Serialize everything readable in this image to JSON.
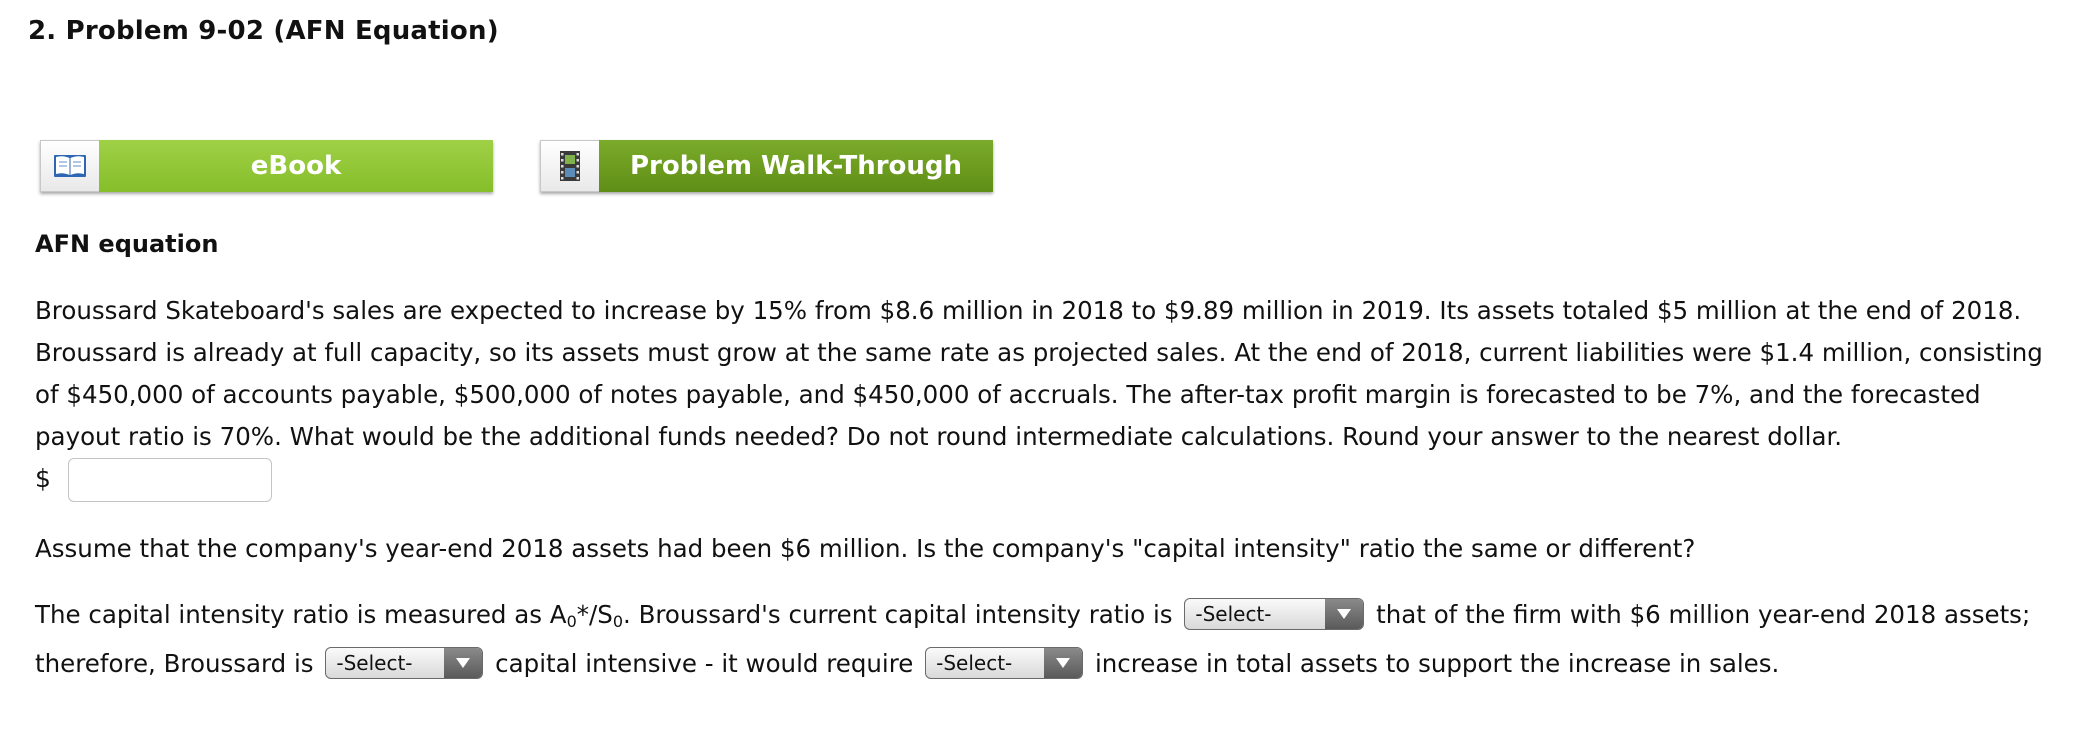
{
  "problem": {
    "title": "2.  Problem 9-02 (AFN Equation)"
  },
  "resources": {
    "ebook_label": "eBook",
    "walkthrough_label": "Problem Walk-Through"
  },
  "section_heading": "AFN equation",
  "question_text": "Broussard Skateboard's sales are expected to increase by 15% from $8.6 million in 2018 to $9.89 million in 2019. Its assets totaled $5 million at the end of 2018. Broussard is already at full capacity, so its assets must grow at the same rate as projected sales. At the end of 2018, current liabilities were $1.4 million, consisting of $450,000 of accounts payable, $500,000 of notes payable, and $450,000 of accruals. The after-tax profit margin is forecasted to be 7%, and the forecasted payout ratio is 70%. What would be the additional funds needed? Do not round intermediate calculations. Round your answer to the nearest dollar.",
  "answer": {
    "currency_symbol": "$",
    "value": ""
  },
  "assumption_text": "Assume that the company's year-end 2018 assets had been $6 million. Is the company's \"capital intensity\" ratio the same or different?",
  "capital_intensity": {
    "part1": "The capital intensity ratio is measured as A",
    "sub1": "0",
    "part2": "*/S",
    "sub2": "0",
    "part3": ". Broussard's current capital intensity ratio is",
    "part4": "that of the firm with $6 million year-end 2018 assets; therefore, Broussard is",
    "part5": "capital intensive - it would require",
    "part6": "increase in total assets to support the increase in sales.",
    "select1": "-Select-",
    "select2": "-Select-",
    "select3": "-Select-"
  }
}
